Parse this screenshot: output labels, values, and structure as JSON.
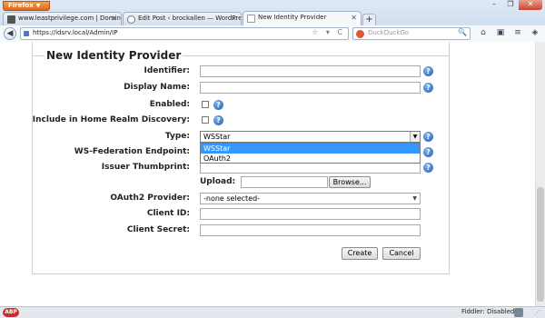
{
  "browser": {
    "menu_button": "Firefox",
    "window_controls": {
      "minimize": "–",
      "maximize": "❐",
      "close": "✕"
    },
    "tabs": [
      {
        "title": "www.leastprivilege.com | Dominick B...",
        "favicon": "leastprivilege-icon",
        "active": false
      },
      {
        "title": "Edit Post ‹ brockallen — WordPress",
        "favicon": "wordpress-icon",
        "active": false
      },
      {
        "title": "New Identity Provider",
        "favicon": "blank-page-icon",
        "active": true
      }
    ],
    "new_tab": "+",
    "url": "https://idsrv.local/Admin/IP",
    "url_icons": "☆ ▾ C",
    "search_placeholder": "DuckDuckGo",
    "search_go": "🔍",
    "toolbar_icons": [
      "home-icon",
      "bookmarks-icon",
      "menu-icon",
      "extension-icon"
    ]
  },
  "form": {
    "legend": "New Identity Provider",
    "identifier_label": "Identifier:",
    "identifier_value": "",
    "display_name_label": "Display Name:",
    "display_name_value": "",
    "enabled_label": "Enabled:",
    "enabled_checked": false,
    "home_realm_label": "Include in Home Realm Discovery:",
    "home_realm_checked": false,
    "type_label": "Type:",
    "type_value": "WSStar",
    "type_options": [
      "WSStar",
      "OAuth2"
    ],
    "wsfed_label": "WS-Federation Endpoint:",
    "issuer_thumb_label": "Issuer Thumbprint:",
    "upload_label": "Upload:",
    "browse_label": "Browse...",
    "oauth2_label": "OAuth2 Provider:",
    "oauth2_value": "-none selected-",
    "client_id_label": "Client ID:",
    "client_secret_label": "Client Secret:",
    "create_label": "Create",
    "cancel_label": "Cancel",
    "help_glyph": "?"
  },
  "status": {
    "fiddler": "Fiddler: Disabled",
    "abp": "ABP"
  },
  "colors": {
    "help_icon": "#1f5fb4",
    "selected_option": "#3399ff",
    "firefox_button": "#e0661a"
  }
}
